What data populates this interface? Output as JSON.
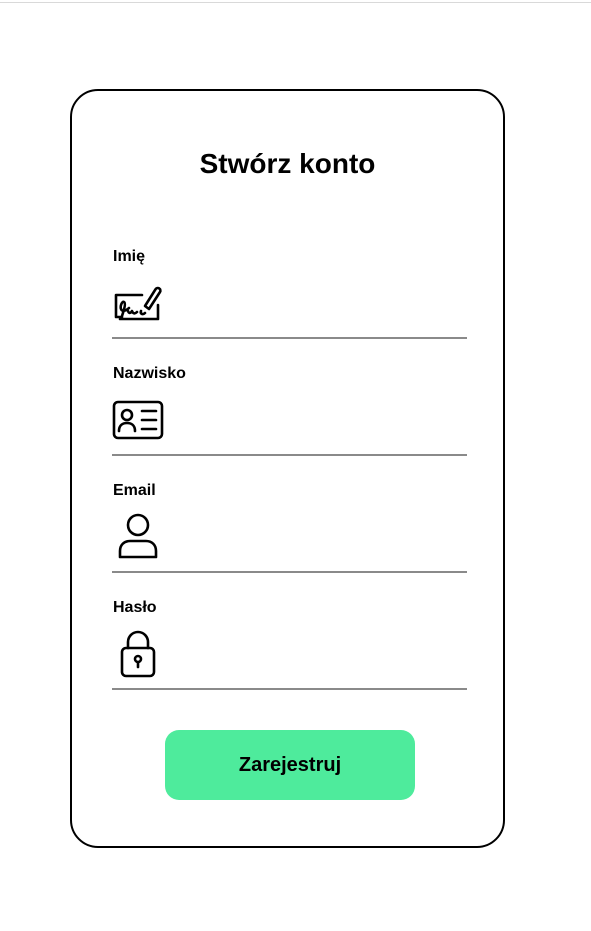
{
  "form": {
    "title": "Stwórz konto",
    "fields": [
      {
        "label": "Imię",
        "icon": "signature-icon",
        "value": "",
        "placeholder": ""
      },
      {
        "label": "Nazwisko",
        "icon": "id-card-icon",
        "value": "",
        "placeholder": ""
      },
      {
        "label": "Email",
        "icon": "user-icon",
        "value": "",
        "placeholder": ""
      },
      {
        "label": "Hasło",
        "icon": "lock-icon",
        "value": "",
        "placeholder": ""
      }
    ],
    "submit_label": "Zarejestruj"
  },
  "colors": {
    "accent": "#4eeb9c",
    "border": "#000000",
    "underline": "#8a8a8a"
  }
}
